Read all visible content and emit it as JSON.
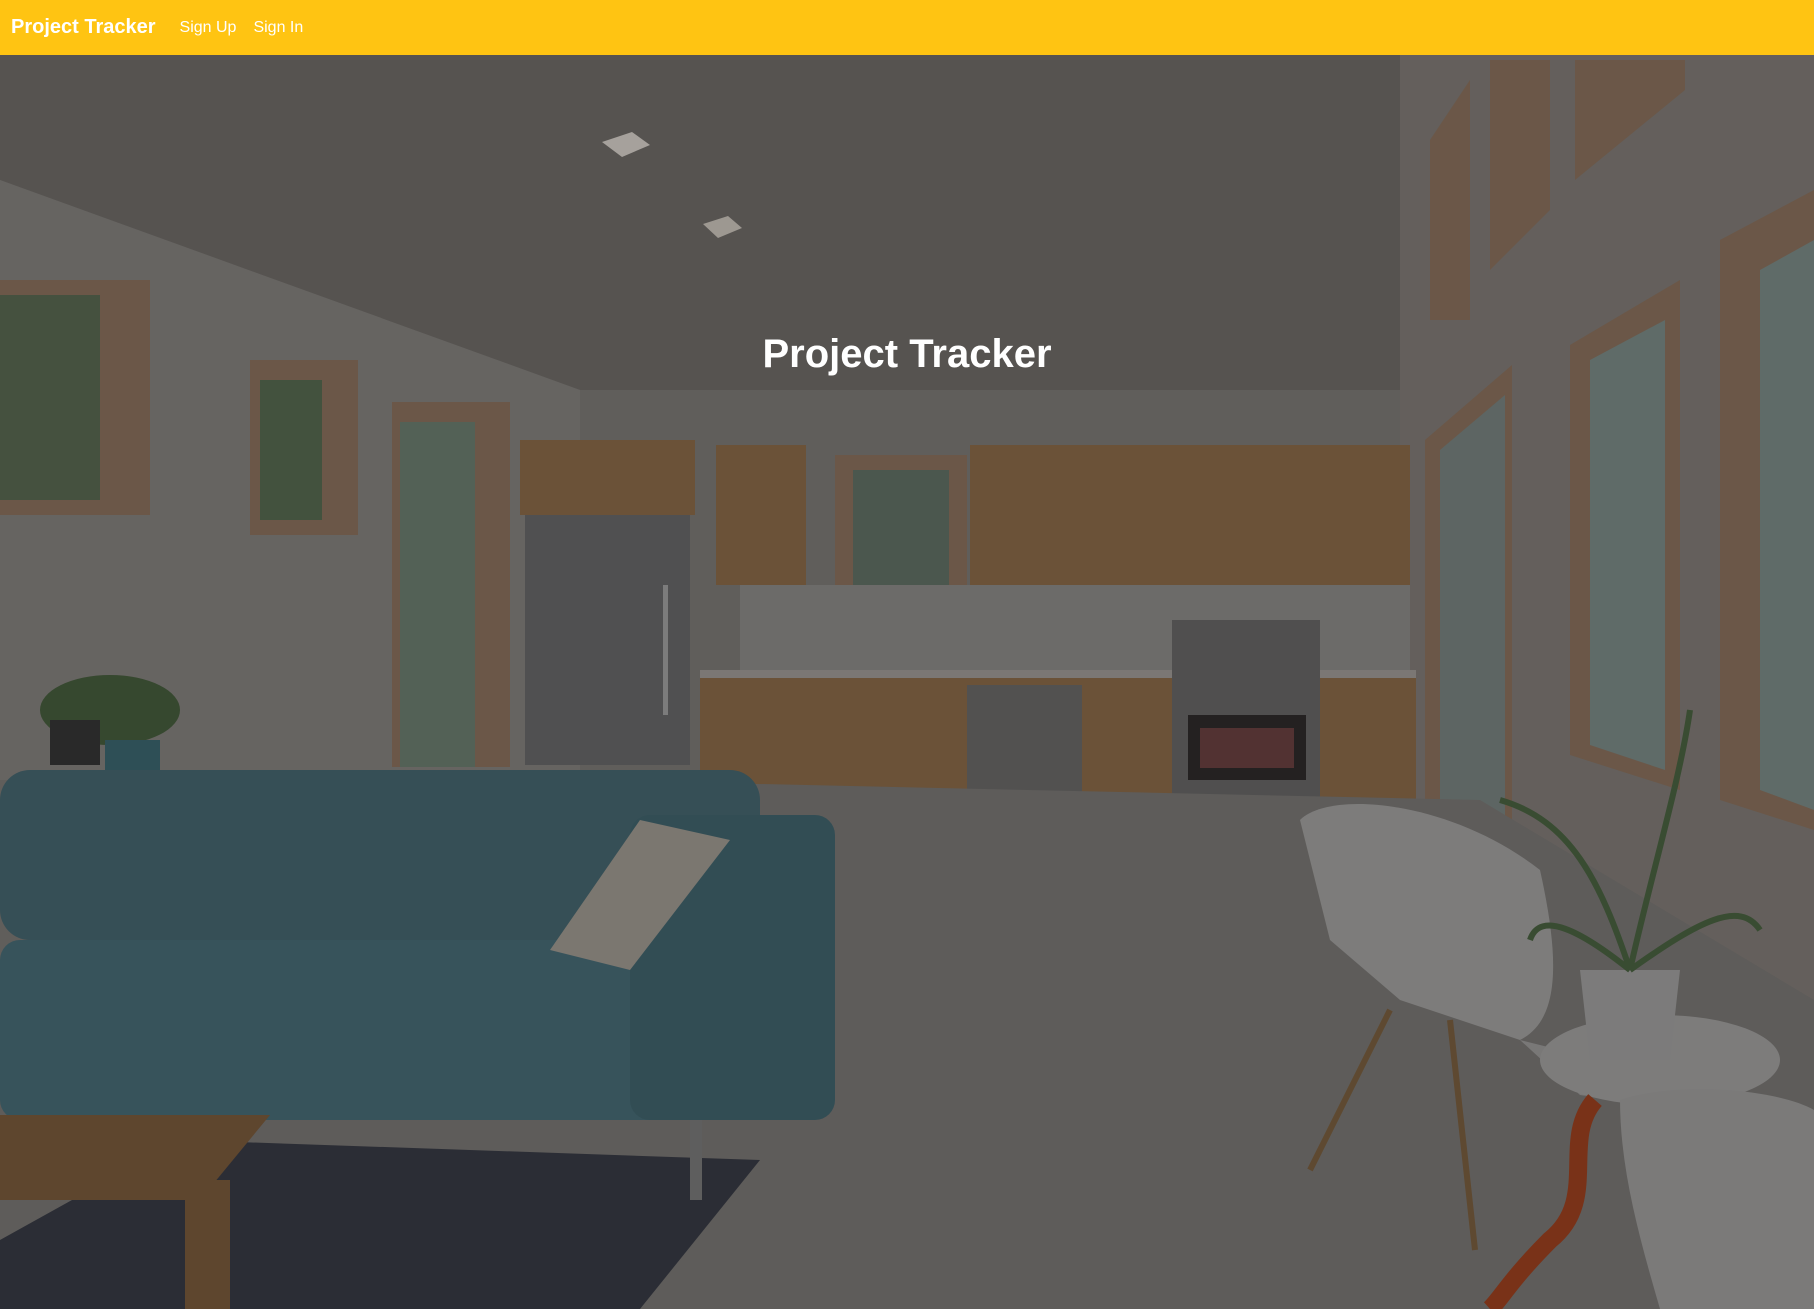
{
  "navbar": {
    "brand": "Project Tracker",
    "links": [
      {
        "label": "Sign Up"
      },
      {
        "label": "Sign In"
      }
    ],
    "color": "#ffc412"
  },
  "hero": {
    "title": "Project Tracker",
    "overlay_color": "#000000"
  }
}
